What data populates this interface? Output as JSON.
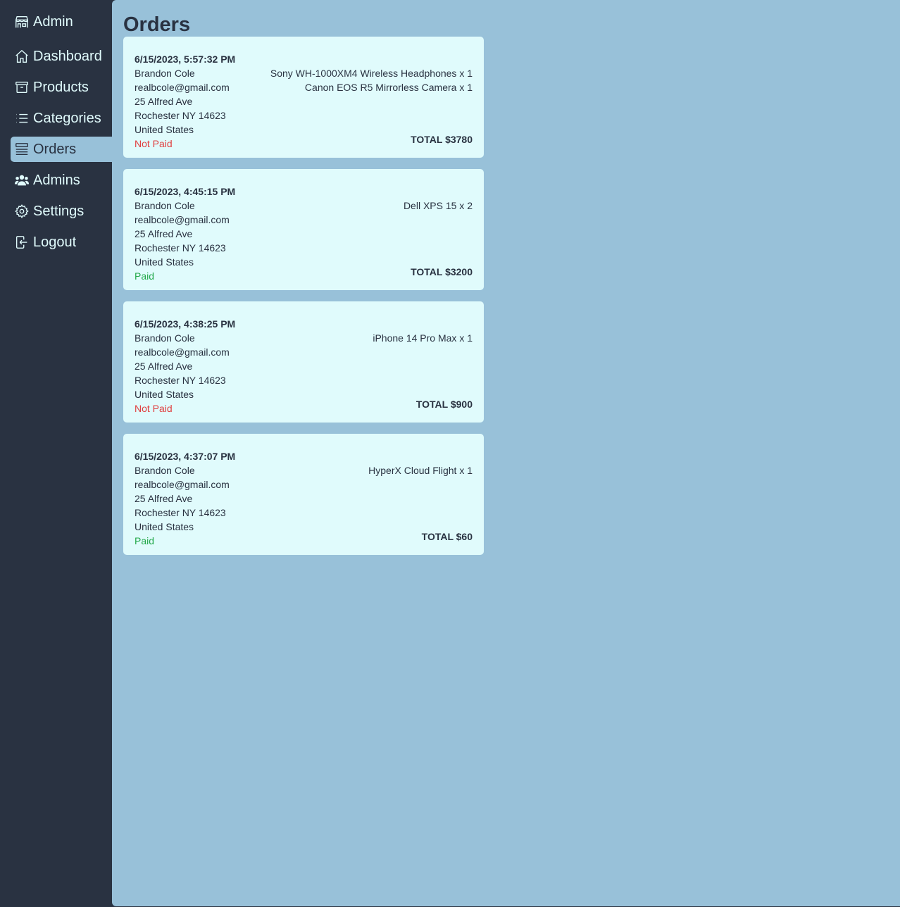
{
  "sidebar": {
    "brand": {
      "label": "Admin",
      "icon": "store-icon"
    },
    "items": [
      {
        "label": "Dashboard",
        "icon": "home-icon"
      },
      {
        "label": "Products",
        "icon": "archive-icon"
      },
      {
        "label": "Categories",
        "icon": "list-icon"
      },
      {
        "label": "Orders",
        "icon": "queue-list-icon",
        "active": true
      },
      {
        "label": "Admins",
        "icon": "users-icon"
      },
      {
        "label": "Settings",
        "icon": "gear-icon"
      },
      {
        "label": "Logout",
        "icon": "logout-icon"
      }
    ]
  },
  "main": {
    "title": "Orders",
    "orders": [
      {
        "date": "6/15/2023, 5:57:32 PM",
        "name": "Brandon Cole",
        "email": "realbcole@gmail.com",
        "street": "25 Alfred Ave",
        "city": "Rochester NY 14623",
        "country": "United States",
        "status": "Not Paid",
        "items": [
          "Sony WH-1000XM4 Wireless Headphones x 1",
          "Canon EOS R5 Mirrorless Camera x 1"
        ],
        "total": "TOTAL $3780"
      },
      {
        "date": "6/15/2023, 4:45:15 PM",
        "name": "Brandon Cole",
        "email": "realbcole@gmail.com",
        "street": "25 Alfred Ave",
        "city": "Rochester NY 14623",
        "country": "United States",
        "status": "Paid",
        "items": [
          "Dell XPS 15 x 2"
        ],
        "total": "TOTAL $3200"
      },
      {
        "date": "6/15/2023, 4:38:25 PM",
        "name": "Brandon Cole",
        "email": "realbcole@gmail.com",
        "street": "25 Alfred Ave",
        "city": "Rochester NY 14623",
        "country": "United States",
        "status": "Not Paid",
        "items": [
          "iPhone 14 Pro Max x 1"
        ],
        "total": "TOTAL $900"
      },
      {
        "date": "6/15/2023, 4:37:07 PM",
        "name": "Brandon Cole",
        "email": "realbcole@gmail.com",
        "street": "25 Alfred Ave",
        "city": "Rochester NY 14623",
        "country": "United States",
        "status": "Paid",
        "items": [
          "HyperX Cloud Flight x 1"
        ],
        "total": "TOTAL $60"
      }
    ]
  },
  "colors": {
    "sidebar_bg": "#293241",
    "main_bg": "#98c1d9",
    "card_bg": "#e0fbfc",
    "paid": "#22a84a",
    "not_paid": "#e03e3e"
  }
}
